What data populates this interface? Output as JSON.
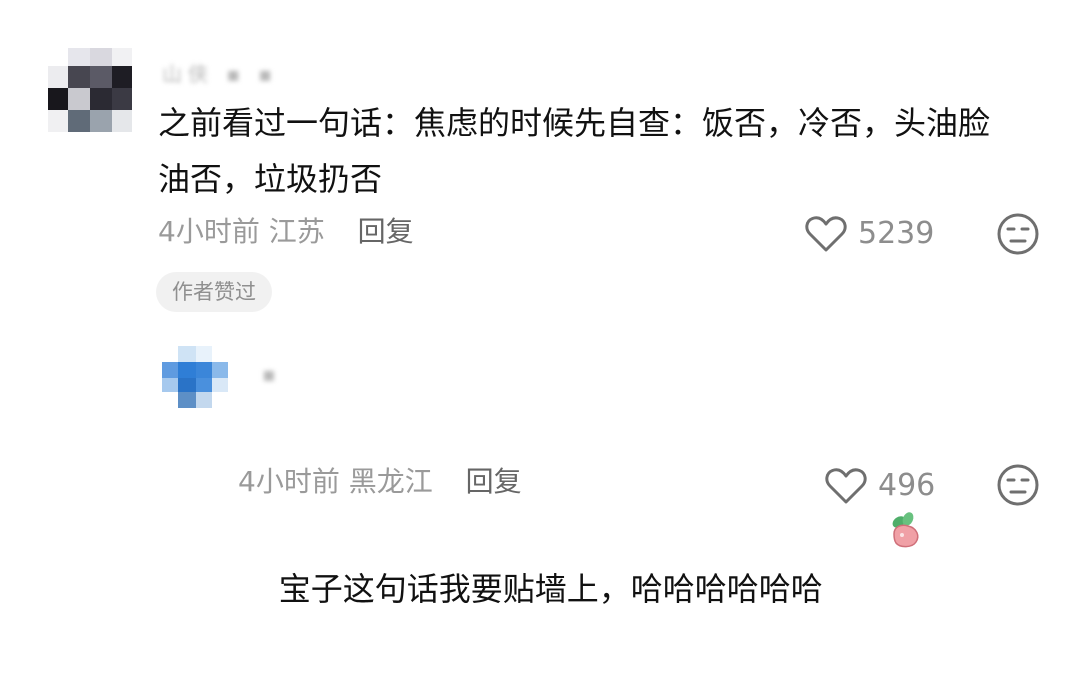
{
  "comments": [
    {
      "username": "山侠 ▪ ▪",
      "text": "之前看过一句话：焦虑的时候先自查：饭否，冷否，头油脸油否，垃圾扔否",
      "time": "4小时前",
      "location": "江苏",
      "reply_label": "回复",
      "like_count": "5239",
      "badge": "作者赞过"
    },
    {
      "username": "▪",
      "text": "宝子这句话我要贴墙上，哈哈哈哈哈哈",
      "time": "4小时前",
      "location": "黑龙江",
      "reply_label": "回复",
      "like_count": "496"
    }
  ],
  "colors": {
    "text": "#111111",
    "meta": "#9a9a9a",
    "badge_bg": "#f1f1f1"
  },
  "icons": [
    "heart-icon",
    "dislike-face-icon",
    "radish-emoji-icon"
  ]
}
